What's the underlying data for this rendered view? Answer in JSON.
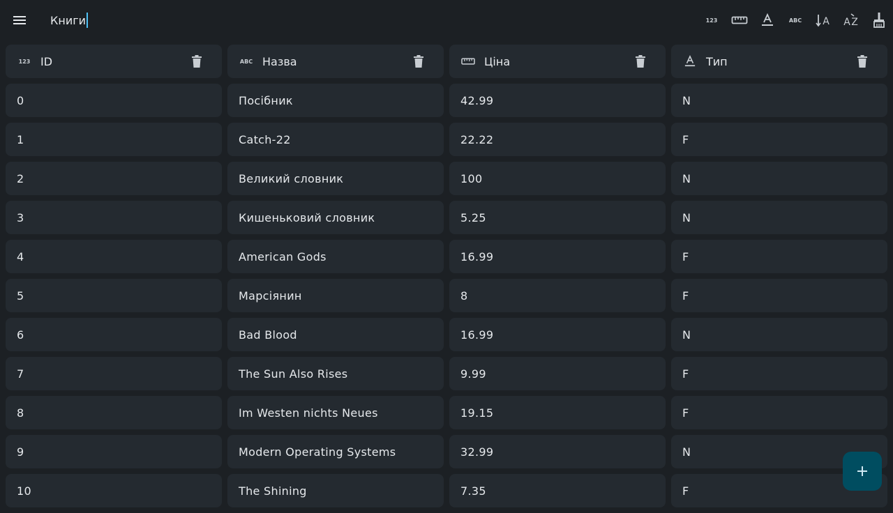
{
  "app": {
    "title": "Книги",
    "colors": {
      "background": "#1c2024",
      "cell": "#242a30",
      "fab": "#004d60",
      "accent": "#4fc3f7"
    }
  },
  "toolbar": {
    "icons": [
      "number-type-icon",
      "ruler-icon",
      "text-color-icon",
      "abc-type-icon",
      "sort-icon",
      "sort-az-icon",
      "broom-icon"
    ],
    "number_icon_text": "123",
    "abc_icon_text": "ABC",
    "sort_a_text": "A",
    "sort_az_a": "A",
    "sort_az_z": "Z"
  },
  "columns": [
    {
      "label": "ID",
      "type_icon": "number-type-icon",
      "type_text": "123"
    },
    {
      "label": "Назва",
      "type_icon": "abc-type-icon",
      "type_text": "ABC"
    },
    {
      "label": "Ціна",
      "type_icon": "ruler-icon",
      "type_text": ""
    },
    {
      "label": "Тип",
      "type_icon": "text-color-icon",
      "type_text": "A"
    }
  ],
  "rows": [
    [
      "0",
      "Посібник",
      "42.99",
      "N"
    ],
    [
      "1",
      "Catch-22",
      "22.22",
      "F"
    ],
    [
      "2",
      "Великий словник",
      "100",
      "N"
    ],
    [
      "3",
      "Кишеньковий словник",
      "5.25",
      "N"
    ],
    [
      "4",
      "American Gods",
      "16.99",
      "F"
    ],
    [
      "5",
      "Марсіянин",
      "8",
      "F"
    ],
    [
      "6",
      "Bad Blood",
      "16.99",
      "N"
    ],
    [
      "7",
      "The Sun Also Rises",
      "9.99",
      "F"
    ],
    [
      "8",
      "Im Westen nichts Neues",
      "19.15",
      "F"
    ],
    [
      "9",
      "Modern Operating Systems",
      "32.99",
      "N"
    ],
    [
      "10",
      "The Shining",
      "7.35",
      "F"
    ]
  ],
  "fab": {
    "icon": "plus-icon"
  }
}
